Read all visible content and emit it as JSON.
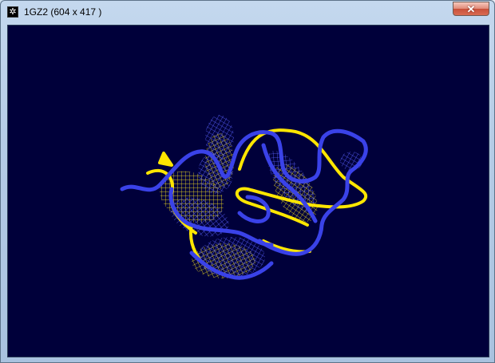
{
  "window": {
    "title": "1GZ2  (604 x 417 )",
    "close_symbol": "✕",
    "app_icon": "molecule-viewer-icon",
    "app_icon_glyph": "✲"
  },
  "viewport": {
    "background": "#00003a",
    "ribbon_colors": {
      "blue_chain": "#3a42e8",
      "yellow_chain": "#ffe600",
      "blue_mesh": "#5a62ff",
      "yellow_mesh": "#f4e020"
    }
  }
}
